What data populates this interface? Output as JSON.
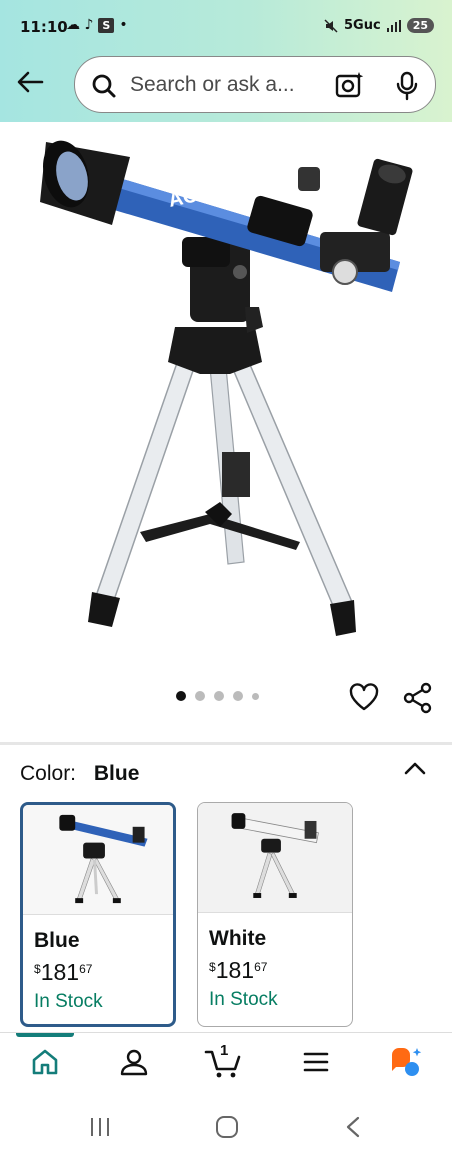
{
  "status": {
    "time": "11:10",
    "left_glyphs": "☁ ♪",
    "s_badge": "S",
    "dot": "•",
    "signal": "5Guc",
    "battery": "25"
  },
  "search": {
    "placeholder": "Search or ask a..."
  },
  "product": {
    "brand_on_tube": "AOMEKIE",
    "carousel_pages": 5,
    "carousel_active": 0
  },
  "variation": {
    "label": "Color:",
    "selected": "Blue",
    "options": [
      {
        "name": "Blue",
        "currency": "$",
        "price_whole": "181",
        "price_fraction": "67",
        "availability": "In Stock"
      },
      {
        "name": "White",
        "currency": "$",
        "price_whole": "181",
        "price_fraction": "67",
        "availability": "In Stock"
      }
    ]
  },
  "bottom_nav": {
    "cart_count": "1",
    "items": [
      "home-icon",
      "account-icon",
      "cart-icon",
      "menu-icon",
      "rufus-icon"
    ]
  },
  "colors": {
    "accent_teal": "#147d7a",
    "in_stock_green": "#067d62",
    "selected_border": "#2e5b8a",
    "tube_blue": "#2f62b8",
    "rufus_orange": "#ff6a13",
    "rufus_blue": "#2e8ff0"
  }
}
